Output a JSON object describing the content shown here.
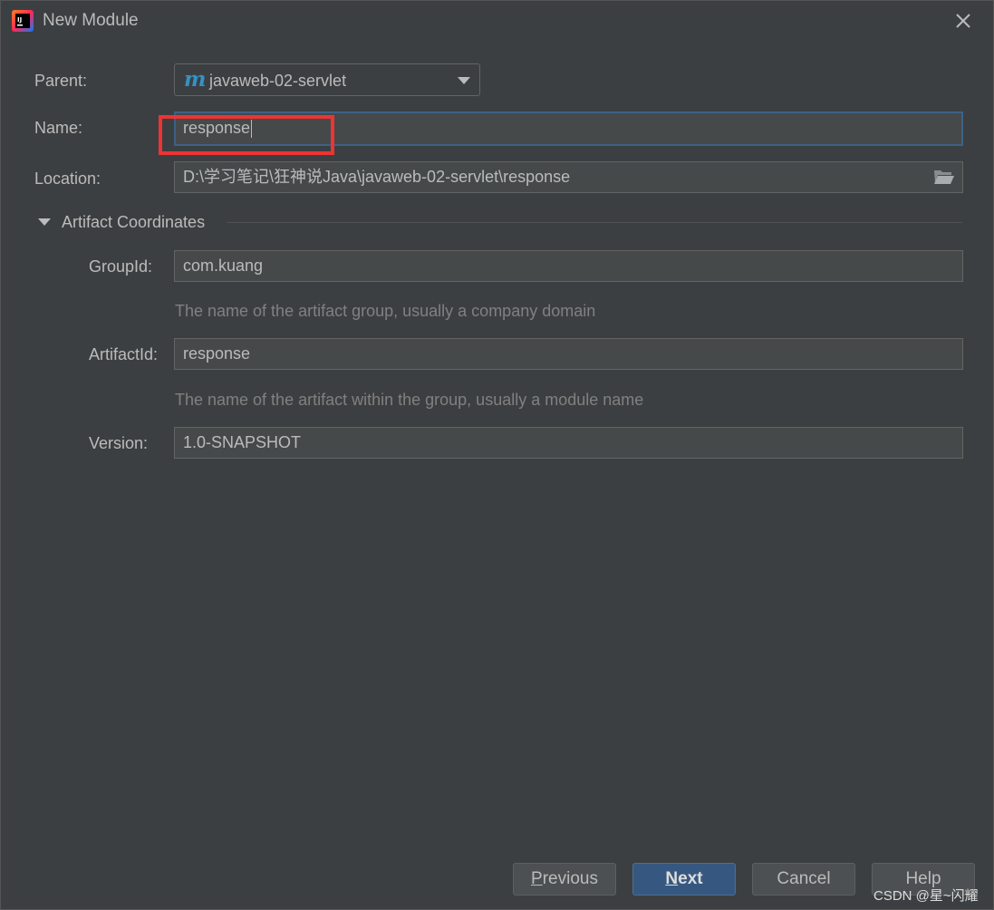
{
  "window": {
    "title": "New Module"
  },
  "form": {
    "parent": {
      "label": "Parent:",
      "value": "javaweb-02-servlet"
    },
    "name": {
      "label": "Name:",
      "value": "response"
    },
    "location": {
      "label": "Location:",
      "value": "D:\\学习笔记\\狂神说Java\\javaweb-02-servlet\\response"
    }
  },
  "artifact": {
    "section_title": "Artifact Coordinates",
    "group_id": {
      "label": "GroupId:",
      "value": "com.kuang",
      "hint": "The name of the artifact group, usually a company domain"
    },
    "artifact_id": {
      "label": "ArtifactId:",
      "value": "response",
      "hint": "The name of the artifact within the group, usually a module name"
    },
    "version": {
      "label": "Version:",
      "value": "1.0-SNAPSHOT"
    }
  },
  "buttons": {
    "previous": {
      "first": "P",
      "rest": "revious"
    },
    "next": {
      "first": "N",
      "rest": "ext"
    },
    "cancel": "Cancel",
    "help": "Help"
  },
  "watermark": "CSDN @星~闪耀",
  "colors": {
    "background": "#3c3f41",
    "accent_focus": "#3d6185",
    "primary_button": "#365880",
    "highlight_annotation": "#ee3333",
    "maven_icon": "#3592c4"
  },
  "icons": {
    "app": "intellij-idea-icon",
    "close": "close-icon",
    "parent": "maven-icon",
    "dropdown": "chevron-down-icon",
    "browse": "folder-open-icon",
    "section_toggle": "triangle-down-icon"
  }
}
